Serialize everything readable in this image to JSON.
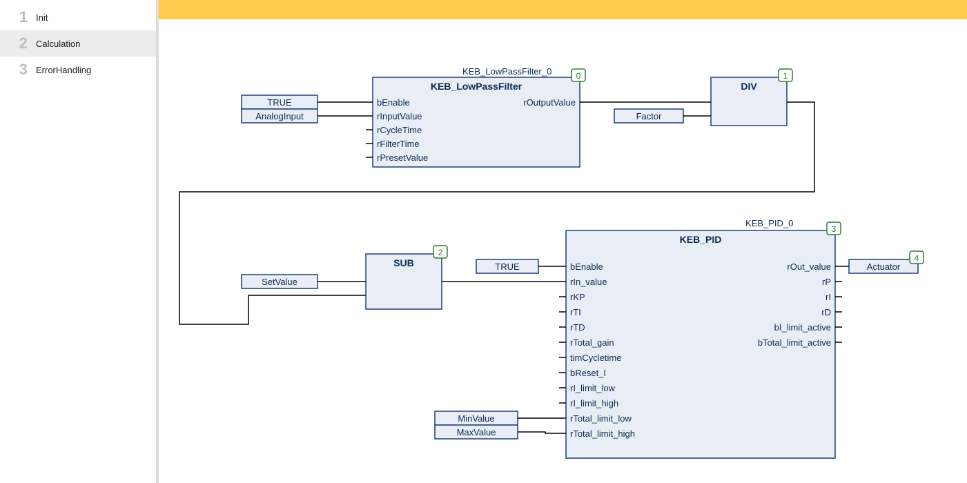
{
  "sidebar": {
    "steps": [
      {
        "num": "1",
        "label": "Init"
      },
      {
        "num": "2",
        "label": "Calculation"
      },
      {
        "num": "3",
        "label": "ErrorHandling"
      }
    ],
    "active_index": 1
  },
  "blocks": {
    "lpf": {
      "instance": "KEB_LowPassFilter_0",
      "type": "KEB_LowPassFilter",
      "badge": "0",
      "inputs": [
        "bEnable",
        "rInputValue",
        "rCycleTime",
        "rFilterTime",
        "rPresetValue"
      ],
      "outputs": [
        "rOutputValue"
      ]
    },
    "div": {
      "type": "DIV",
      "badge": "1"
    },
    "sub": {
      "type": "SUB",
      "badge": "2"
    },
    "pid": {
      "instance": "KEB_PID_0",
      "type": "KEB_PID",
      "badge": "3",
      "inputs": [
        "bEnable",
        "rIn_value",
        "rKP",
        "rTI",
        "rTD",
        "rTotal_gain",
        "timCycletime",
        "bReset_I",
        "rI_limit_low",
        "rI_limit_high",
        "rTotal_limit_low",
        "rTotal_limit_high"
      ],
      "outputs": [
        "rOut_value",
        "rP",
        "rI",
        "rD",
        "bI_limit_active",
        "bTotal_limit_active"
      ]
    },
    "actuator_badge": "4"
  },
  "vars": {
    "true": "TRUE",
    "analog": "AnalogInput",
    "factor": "Factor",
    "setvalue": "SetValue",
    "actuator": "Actuator",
    "minvalue": "MinValue",
    "maxvalue": "MaxValue"
  }
}
